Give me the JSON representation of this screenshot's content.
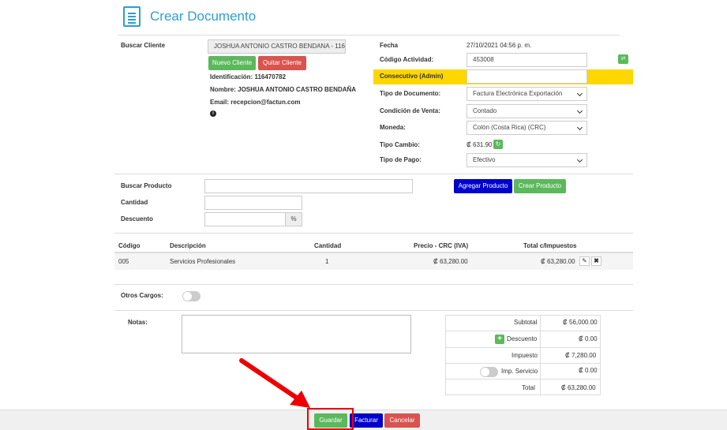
{
  "header": {
    "title": "Crear Documento"
  },
  "client": {
    "search_label": "Buscar Cliente",
    "search_value": "JOSHUA ANTONIO CASTRO BENDANA - 116",
    "new_btn": "Nuevo Cliente",
    "remove_btn": "Quitar Cliente",
    "id_line": "Identificación: 116470782",
    "name_line": "Nombre: JOSHUA ANTONIO CASTRO BENDAÑA",
    "email_line": "Email: recepcion@factun.com"
  },
  "doc": {
    "fecha_label": "Fecha",
    "fecha_value": "27/10/2021 04:56 p. m.",
    "actividad_label": "Código Actividad:",
    "actividad_value": "453008",
    "consecutivo_label": "Consecutivo (Admin)",
    "consecutivo_value": "",
    "tipo_doc_label": "Tipo de Documento:",
    "tipo_doc_value": "Factura Electrónica Exportación",
    "condicion_label": "Condición de Venta:",
    "condicion_value": "Contado",
    "moneda_label": "Moneda:",
    "moneda_value": "Colón (Costa Rica) (CRC)",
    "tipo_cambio_label": "Tipo Cambio:",
    "tipo_cambio_value": "₡ 631.90",
    "tipo_pago_label": "Tipo de Pago:",
    "tipo_pago_value": "Efectivo",
    "highlight_color": "#ffd700"
  },
  "product": {
    "search_label": "Buscar Producto",
    "cantidad_label": "Cantidad",
    "descuento_label": "Descuento",
    "percent": "%",
    "add_btn": "Agregar Producto",
    "create_btn": "Crear Producto"
  },
  "table": {
    "headers": [
      "Código",
      "Descripción",
      "Cantidad",
      "Precio - CRC (IVA)",
      "Total c/Impuestos"
    ],
    "rows": [
      {
        "codigo": "005",
        "descripcion": "Servicios Profesionales",
        "cantidad": "1",
        "precio": "₡ 63,280.00",
        "total": "₡ 63,280.00"
      }
    ]
  },
  "otros_cargos": {
    "label": "Otros Cargos:"
  },
  "notas": {
    "label": "Notas:"
  },
  "totals": {
    "subtotal_label": "Subtotal",
    "subtotal": "₡ 56,000.00",
    "descuento_label": "Descuento",
    "descuento": "₡ 0.00",
    "impuesto_label": "Impuesto",
    "impuesto": "₡ 7,280.00",
    "servicio_label": "Imp. Servicio",
    "servicio": "₡ 0.00",
    "total_label": "Total",
    "total": "₡ 63,280.00"
  },
  "footer": {
    "guardar": "Guardar",
    "facturar": "Facturar",
    "cancelar": "Cancelar"
  },
  "annotation_color": "#ee0000"
}
